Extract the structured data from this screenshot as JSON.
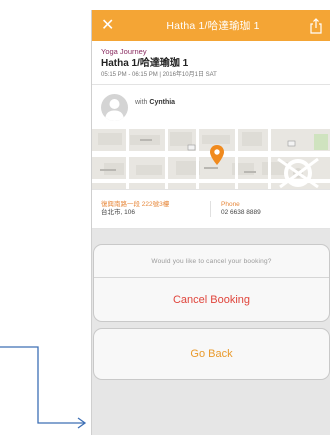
{
  "navbar": {
    "close_icon": "close-icon",
    "title": "Hatha 1/哈達瑜珈 1",
    "share_icon": "share-icon",
    "color": "#f4a535"
  },
  "class_info": {
    "brand": "Yoga Journey",
    "name": "Hatha 1/哈達瑜珈 1",
    "time": "05:15 PM - 06:15 PM | 2016年10月1日 SAT"
  },
  "instructor": {
    "prefix": "with",
    "name": "Cynthia",
    "avatar_icon": "person-avatar-icon"
  },
  "map": {
    "marker_icon": "map-pin-icon",
    "marker_color": "#f08a1e"
  },
  "contact": {
    "address_line1": "復興南路一段 222號3樓",
    "address_line2": "台北市, 106",
    "phone_label": "Phone",
    "phone_number": "02 6638 8889"
  },
  "action_sheet": {
    "message": "Would you like to cancel your booking?",
    "cancel_label": "Cancel Booking",
    "cancel_color": "#e0453c",
    "back_label": "Go Back",
    "back_color": "#e99a2c"
  },
  "annotation": {
    "arrow_color": "#3d6fb5"
  }
}
